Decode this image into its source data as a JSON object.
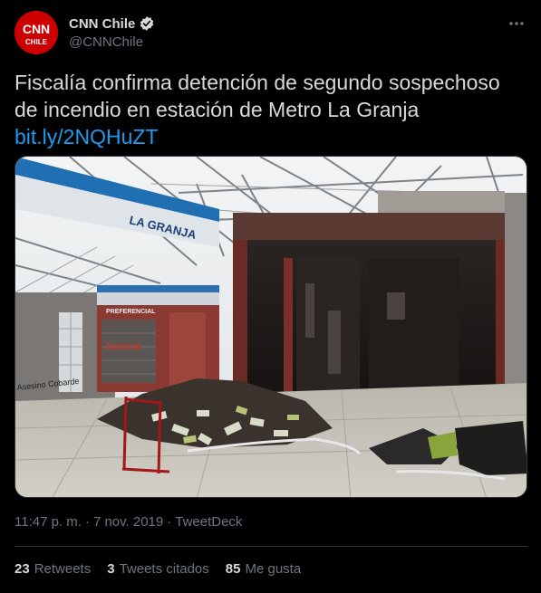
{
  "author": {
    "display_name": "CNN Chile",
    "handle": "@CNNChile",
    "avatar_logo_top": "CNN",
    "avatar_logo_bottom": "CHILE",
    "verified": true
  },
  "tweet": {
    "text": "Fiscalía confirma detención de segundo sospechoso de incendio en estación de Metro La Granja",
    "link": "bit.ly/2NQHuZT"
  },
  "media": {
    "sign_text": "LA GRANJA",
    "booth_text": "PREFERENCIAL",
    "graffiti_text": "Justicia",
    "wall_graffiti": "Asesino Cobarde"
  },
  "meta": {
    "time": "11:47 p. m.",
    "separator": "·",
    "date": "7 nov. 2019",
    "source": "TweetDeck"
  },
  "stats": {
    "retweets_count": "23",
    "retweets_label": "Retweets",
    "quotes_count": "3",
    "quotes_label": "Tweets citados",
    "likes_count": "85",
    "likes_label": "Me gusta"
  },
  "colors": {
    "background": "#000000",
    "text": "#d9d9d9",
    "secondary_text": "#6e767d",
    "link": "#1d9bf0",
    "brand_red": "#cc0000",
    "verified_badge": "#d9d9d9"
  }
}
